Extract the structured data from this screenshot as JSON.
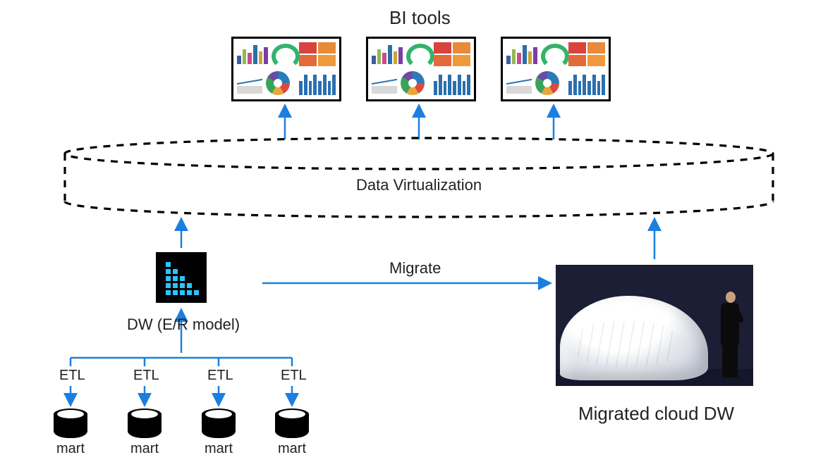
{
  "titles": {
    "bi_tools": "BI tools",
    "data_virtualization": "Data Virtualization",
    "migrate": "Migrate",
    "dw_model": "DW (E/R model)",
    "migrated_cloud_dw": "Migrated cloud DW"
  },
  "etl_labels": [
    "ETL",
    "ETL",
    "ETL",
    "ETL"
  ],
  "mart_labels": [
    "mart",
    "mart",
    "mart",
    "mart"
  ],
  "colors": {
    "arrow": "#1a7fe0",
    "arrow_dark": "#1566c0",
    "dash": "#000000",
    "dw_accent": "#29c4ff"
  },
  "dashboards": 3,
  "marts": 4
}
